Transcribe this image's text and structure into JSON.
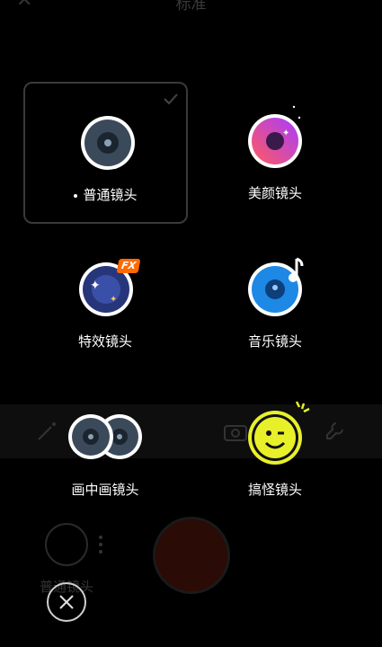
{
  "background": {
    "title": "标准",
    "lens_label": "普通镜头"
  },
  "lens_options": [
    {
      "label": "普通镜头",
      "selected": true,
      "icon": "normal-lens-icon"
    },
    {
      "label": "美颜镜头",
      "selected": false,
      "icon": "beauty-lens-icon"
    },
    {
      "label": "特效镜头",
      "selected": false,
      "icon": "effects-lens-icon",
      "badge": "FX"
    },
    {
      "label": "音乐镜头",
      "selected": false,
      "icon": "music-lens-icon"
    },
    {
      "label": "画中画镜头",
      "selected": false,
      "icon": "pip-lens-icon"
    },
    {
      "label": "搞怪镜头",
      "selected": false,
      "icon": "funny-lens-icon"
    }
  ],
  "colors": {
    "accent_blue": "#1e88e5",
    "beauty_gradient_start": "#ff5a5f",
    "beauty_gradient_end": "#a83cff",
    "funny_yellow": "#e8f02a",
    "fx_badge": "#ff6a00"
  }
}
